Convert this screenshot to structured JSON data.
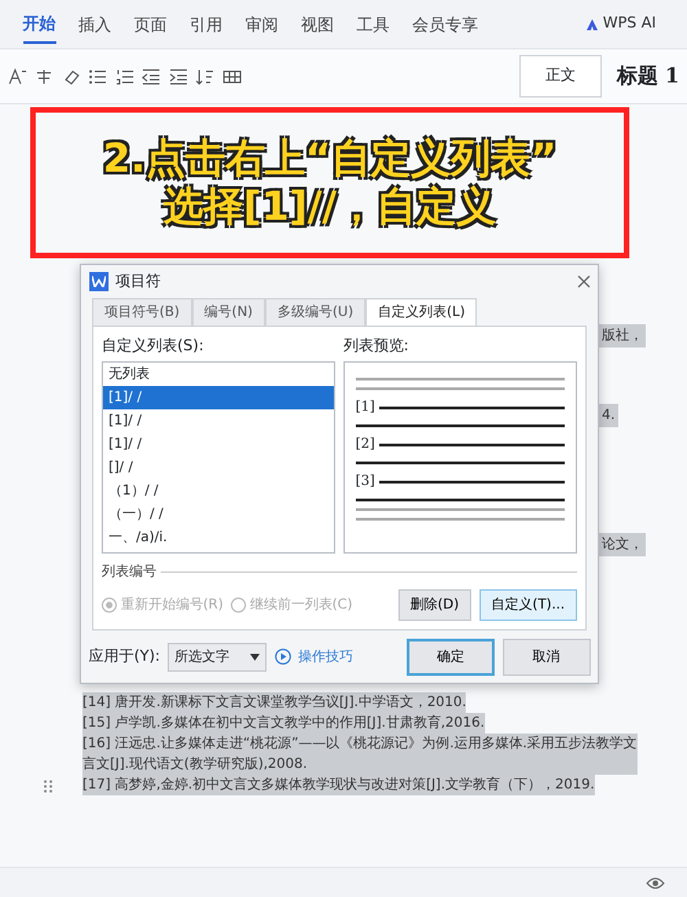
{
  "menu_tabs": [
    {
      "label": "开始",
      "selected": true
    },
    {
      "label": "插入",
      "selected": false
    },
    {
      "label": "页面",
      "selected": false
    },
    {
      "label": "引用",
      "selected": false
    },
    {
      "label": "审阅",
      "selected": false
    },
    {
      "label": "视图",
      "selected": false
    },
    {
      "label": "工具",
      "selected": false
    },
    {
      "label": "会员专享",
      "selected": false
    }
  ],
  "ai_button": "WPS AI",
  "styles": [
    "正文",
    "标题 1"
  ],
  "caption": [
    "2.点击右上“自定义列表”",
    "选择[1]//，自定义"
  ],
  "dialog": {
    "title": "项目符",
    "tabs": [
      {
        "label": "项目符号(B)",
        "selected": false
      },
      {
        "label": "编号(N)",
        "selected": false
      },
      {
        "label": "多级编号(U)",
        "selected": false
      },
      {
        "label": "自定义列表(L)",
        "selected": true
      }
    ],
    "list_label": "自定义列表(S):",
    "list_items": [
      {
        "label": "无列表",
        "selected": false
      },
      {
        "label": "[1]/ /",
        "selected": true
      },
      {
        "label": "[1]/ /",
        "selected": false
      },
      {
        "label": "[1]/ /",
        "selected": false
      },
      {
        "label": "[]/ /",
        "selected": false
      },
      {
        "label": "（1）/ /",
        "selected": false
      },
      {
        "label": "（一）/ /",
        "selected": false
      },
      {
        "label": "一、/a)/i.",
        "selected": false
      }
    ],
    "preview_label": "列表预览:",
    "preview_numbers": [
      "[1]",
      "[2]",
      "[3]"
    ],
    "group_label": "列表编号",
    "radios": [
      {
        "label": "重新开始编号(R)",
        "checked": true,
        "disabled": true
      },
      {
        "label": "继续前一列表(C)",
        "checked": false,
        "disabled": true
      }
    ],
    "buttons": [
      {
        "label": "删除(D)",
        "highlighted": false
      },
      {
        "label": "自定义(T)...",
        "highlighted": true
      }
    ],
    "apply_label": "应用于(Y):",
    "apply_value": "所选文字",
    "tips_link": "操作技巧",
    "footer_buttons": [
      {
        "label": "确定",
        "default": true
      },
      {
        "label": "取消",
        "default": false
      }
    ]
  },
  "doc_fragments": [
    "版社，",
    "4.",
    "论文，"
  ],
  "references": [
    "[14] 唐开发.新课标下文言文课堂教学刍议[J].中学语文，2010.",
    "[15] 卢学凯.多媒体在初中文言文教学中的作用[J].甘肃教育,2016.",
    "[16] 汪远忠.让多媒体走进“桃花源”——以《桃花源记》为例.运用多媒体.采用五步法教学文言文[J].现代语文(教学研究版),2008.",
    "[17] 高梦婷,金婷.初中文言文多媒体教学现状与改进对策[J].文学教育（下），2019."
  ]
}
